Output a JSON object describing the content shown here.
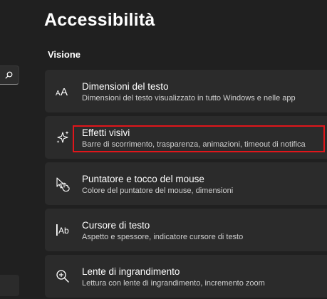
{
  "page": {
    "title": "Accessibilità",
    "section": "Visione"
  },
  "colors": {
    "background": "#202020",
    "card": "#2b2b2b",
    "highlight": "#e0161b"
  },
  "settings": [
    {
      "icon": "text-size-icon",
      "title": "Dimensioni del testo",
      "subtitle": "Dimensioni del testo visualizzato in tutto Windows e nelle app"
    },
    {
      "icon": "sparkle-icon",
      "title": "Effetti visivi",
      "subtitle": "Barre di scorrimento, trasparenza, animazioni, timeout di notifica"
    },
    {
      "icon": "mouse-pointer-touch-icon",
      "title": "Puntatore e tocco del mouse",
      "subtitle": "Colore del puntatore del mouse, dimensioni"
    },
    {
      "icon": "text-cursor-icon",
      "title": "Cursore di testo",
      "subtitle": "Aspetto e spessore, indicatore cursore di testo"
    },
    {
      "icon": "magnifier-icon",
      "title": "Lente di ingrandimento",
      "subtitle": "Lettura con lente di ingrandimento, incremento zoom"
    }
  ]
}
